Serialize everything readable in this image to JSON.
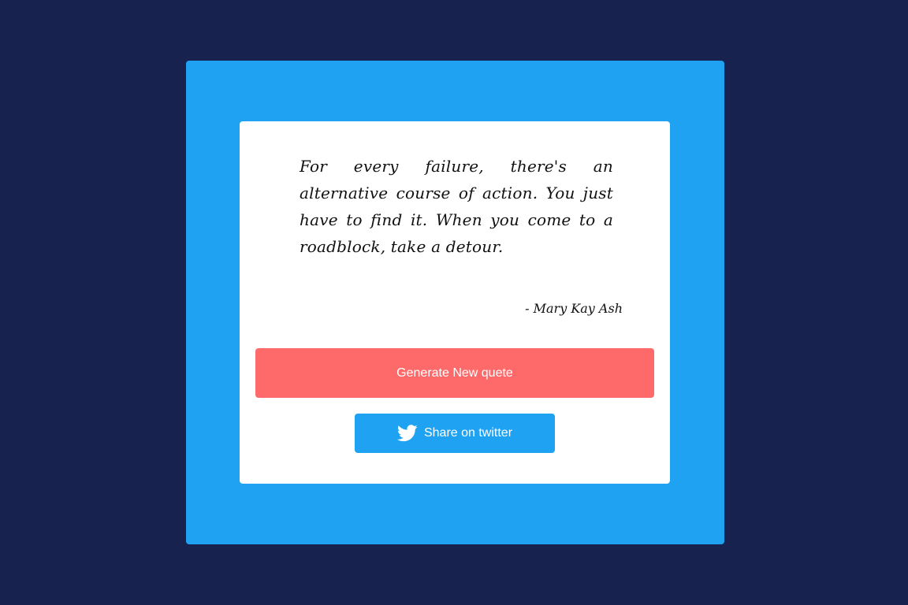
{
  "quote": {
    "text": "For every failure, there's an alternative course of action. You just have to find it. When you come to a roadblock, take a detour.",
    "author": "- Mary Kay Ash"
  },
  "buttons": {
    "generate_label": "Generate New quete",
    "twitter_label": "Share on twitter",
    "twitter_icon": "twitter-bird-icon"
  },
  "colors": {
    "background": "#17224e",
    "frame": "#1fa2f2",
    "card": "#ffffff",
    "generate_button": "#fe6a6a",
    "twitter_button": "#1fa2f2"
  }
}
